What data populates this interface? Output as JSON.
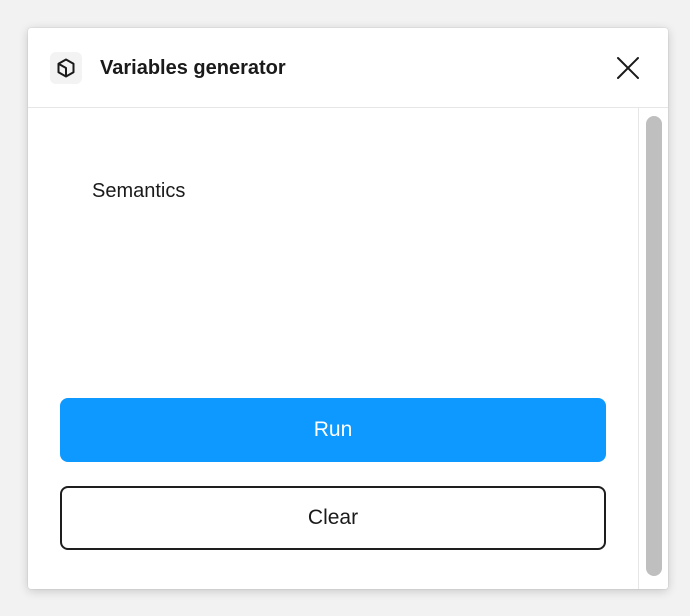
{
  "window": {
    "title": "Variables generator",
    "icon": "plugin-cube-icon",
    "close_icon": "close-icon"
  },
  "content": {
    "section_label": "Semantics",
    "run_label": "Run",
    "clear_label": "Clear"
  },
  "colors": {
    "accent": "#0d99ff",
    "text": "#1a1a1a",
    "scrollbar": "#bfbfbf"
  }
}
